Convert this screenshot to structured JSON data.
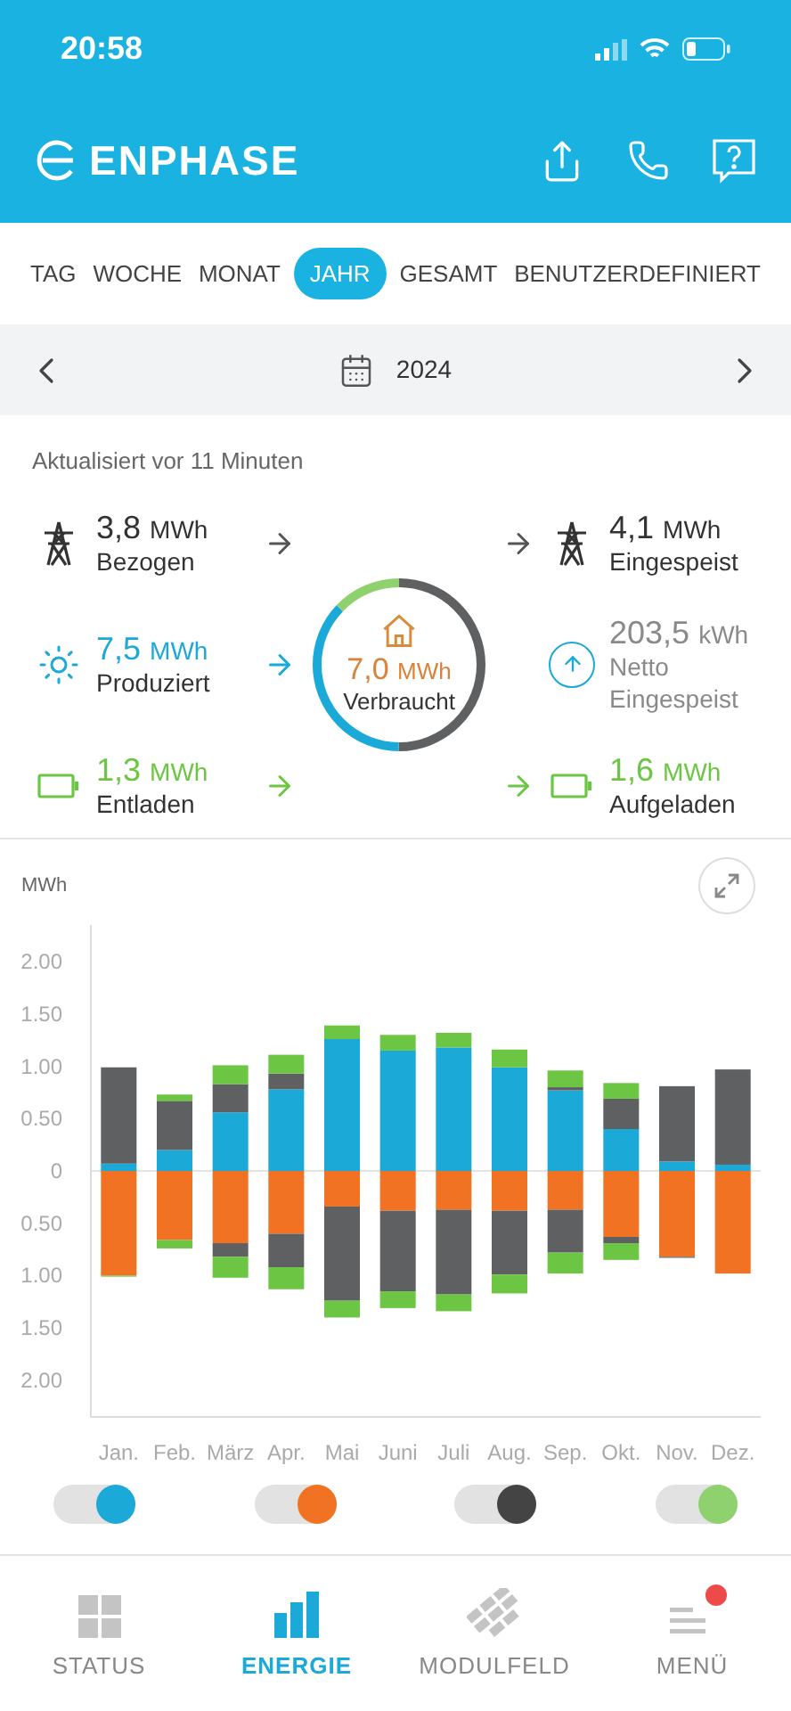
{
  "status_bar": {
    "time": "20:58"
  },
  "header": {
    "logo": "ENPHASE"
  },
  "period_tabs": [
    {
      "label": "TAG",
      "selected": false
    },
    {
      "label": "WOCHE",
      "selected": false
    },
    {
      "label": "MONAT",
      "selected": false
    },
    {
      "label": "JAHR",
      "selected": true
    },
    {
      "label": "GESAMT",
      "selected": false
    },
    {
      "label": "BENUTZERDEFINIERT",
      "selected": false
    }
  ],
  "date_bar": {
    "date": "2024"
  },
  "updated": "Aktualisiert vor 11 Minuten",
  "sources": [
    {
      "kind": "grid",
      "color": "#333333",
      "value": "3,8",
      "unit": "MWh",
      "label": "Bezogen"
    },
    {
      "kind": "solar",
      "color": "#1ba9d8",
      "value": "7,5",
      "unit": "MWh",
      "label": "Produziert"
    },
    {
      "kind": "battery",
      "color": "#6cc644",
      "value": "1,3",
      "unit": "MWh",
      "label": "Entladen"
    }
  ],
  "consumption": {
    "value": "7,0",
    "unit": "MWh",
    "label": "Verbraucht"
  },
  "destinations": [
    {
      "kind": "grid",
      "color": "#333333",
      "value": "4,1",
      "unit": "MWh",
      "label": "Eingespeist"
    },
    {
      "kind": "net",
      "color": "#8a8a8a",
      "value": "203,5",
      "unit": "kWh",
      "label": "Netto Eingespeist"
    },
    {
      "kind": "battery",
      "color": "#6cc644",
      "value": "1,6",
      "unit": "MWh",
      "label": "Aufgeladen"
    }
  ],
  "chart_data": {
    "type": "bar",
    "ylabel": "MWh",
    "stacked": true,
    "categories": [
      "Jan.",
      "Feb.",
      "März",
      "Apr.",
      "Mai",
      "Juni",
      "Juli",
      "Aug.",
      "Sep.",
      "Okt.",
      "Nov.",
      "Dez."
    ],
    "yticks": [
      {
        "value": 2,
        "label": "2.00"
      },
      {
        "value": 1.5,
        "label": "1.50"
      },
      {
        "value": 1,
        "label": "1.00"
      },
      {
        "value": 0.5,
        "label": "0.50"
      },
      {
        "value": 0,
        "label": "0"
      },
      {
        "value": -0.5,
        "label": "0.50"
      },
      {
        "value": -1,
        "label": "1.00"
      },
      {
        "value": -1.5,
        "label": "1.50"
      },
      {
        "value": -2,
        "label": "2.00"
      }
    ],
    "ylim": [
      -2.35,
      2.35
    ],
    "series": [
      {
        "color": "#1ba9d8",
        "values": [
          0.07,
          0.2,
          0.56,
          0.78,
          1.26,
          1.15,
          1.18,
          0.99,
          0.77,
          0.4,
          0.09,
          0.06
        ]
      },
      {
        "color": "#5f6062",
        "values": [
          0.92,
          0.47,
          0.27,
          0.15,
          0,
          0,
          0,
          0,
          0.03,
          0.29,
          0.72,
          0.91
        ]
      },
      {
        "color": "#6cc644",
        "values": [
          0,
          0.06,
          0.18,
          0.18,
          0.13,
          0.15,
          0.14,
          0.17,
          0.16,
          0.15,
          0,
          0
        ]
      },
      {
        "color": "#f07222",
        "values": [
          -1.0,
          -0.66,
          -0.69,
          -0.6,
          -0.34,
          -0.38,
          -0.37,
          -0.38,
          -0.37,
          -0.63,
          -0.82,
          -0.98
        ]
      },
      {
        "color": "#5f6062",
        "values": [
          0,
          0,
          -0.13,
          -0.32,
          -0.9,
          -0.77,
          -0.81,
          -0.61,
          -0.41,
          -0.06,
          -0.01,
          0
        ]
      },
      {
        "color": "#6cc644",
        "values": [
          -0.01,
          -0.08,
          -0.2,
          -0.21,
          -0.16,
          -0.16,
          -0.16,
          -0.18,
          -0.2,
          -0.16,
          0,
          0
        ]
      }
    ]
  },
  "legend_toggles": [
    {
      "color": "#1ba9d8",
      "on": true
    },
    {
      "color": "#f07222",
      "on": true
    },
    {
      "color": "#444444",
      "on": true
    },
    {
      "color": "#8fd16f",
      "on": true
    }
  ],
  "bottom_nav": [
    {
      "kind": "status",
      "label": "STATUS",
      "selected": false,
      "badge": false
    },
    {
      "kind": "energy",
      "label": "ENERGIE",
      "selected": true,
      "badge": false
    },
    {
      "kind": "array",
      "label": "MODULFELD",
      "selected": false,
      "badge": false
    },
    {
      "kind": "menu",
      "label": "MENÜ",
      "selected": false,
      "badge": true
    }
  ]
}
